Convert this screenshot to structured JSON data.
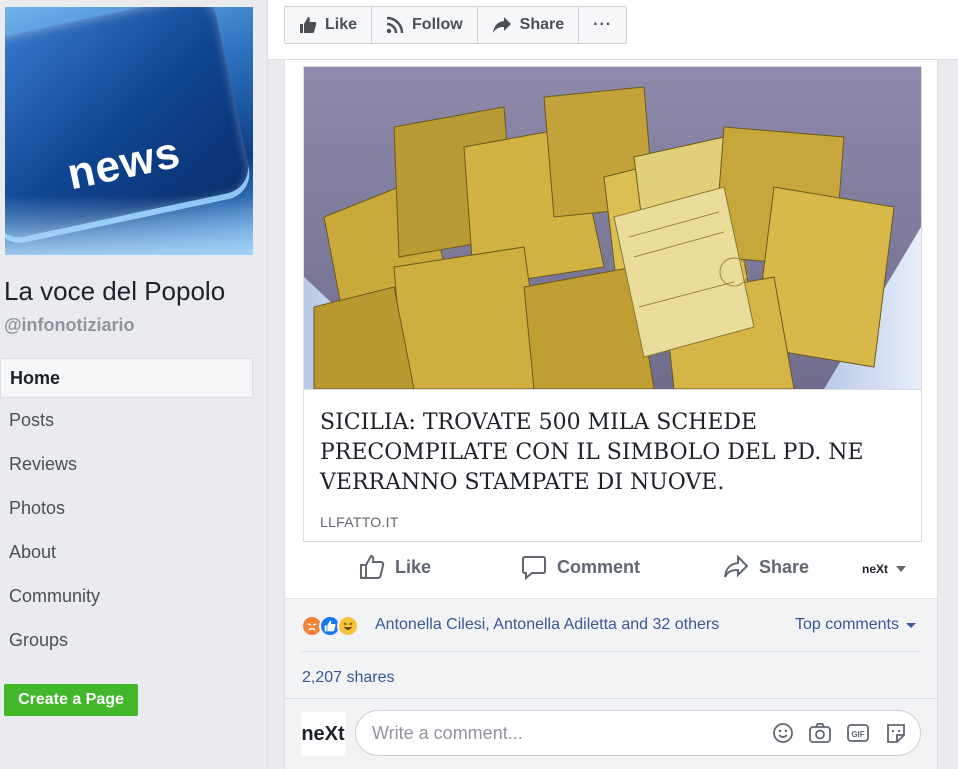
{
  "page": {
    "name": "La voce del Popolo",
    "handle": "@infonotiziario",
    "profile_key_label": "news"
  },
  "nav": {
    "items": [
      "Home",
      "Posts",
      "Reviews",
      "Photos",
      "About",
      "Community",
      "Groups"
    ],
    "active": "Home",
    "create_page": "Create a Page"
  },
  "top_actions": {
    "like": "Like",
    "follow": "Follow",
    "share": "Share",
    "more": "···"
  },
  "post": {
    "link": {
      "headline": "SICILIA: TROVATE 500 MILA SCHEDE PRECOMPILATE CON IL SIMBOLO DEL PD. NE VERRANNO STAMPATE DI NUOVE.",
      "domain": "LLFATTO.IT"
    },
    "actions": {
      "like": "Like",
      "comment": "Comment",
      "share": "Share",
      "actor": "neXt"
    },
    "reactions": {
      "names": "Antonella Cilesi, Antonella Adiletta and 32 others",
      "sort": "Top comments",
      "shares": "2,207 shares"
    },
    "comment_box": {
      "avatar_text": "neXt",
      "placeholder": "Write a comment..."
    }
  },
  "colors": {
    "link_blue": "#385898",
    "create_green": "#42b72a",
    "background": "#e9ebee"
  }
}
